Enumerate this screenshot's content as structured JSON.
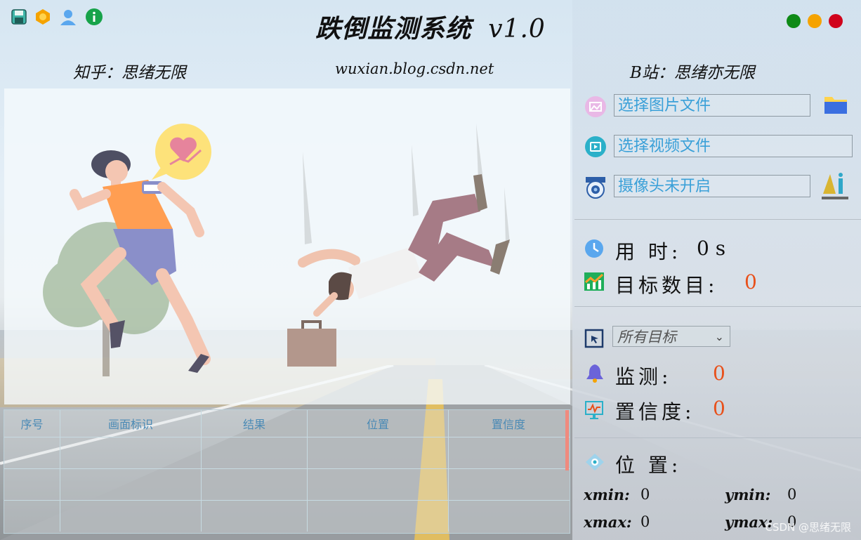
{
  "window": {
    "title": "跌倒监测系统",
    "version": "v1.0",
    "subtitle_left": "知乎：思绪无限",
    "subtitle_center": "wuxian.blog.csdn.net",
    "subtitle_right": "B站：思绪亦无限",
    "watermark": "CSDN @思绪无限"
  },
  "topbar": {
    "icons": [
      "save-icon",
      "hexagon-icon",
      "user-icon",
      "info-icon"
    ],
    "window_controls": [
      {
        "name": "minimize",
        "color": "#0e8a16"
      },
      {
        "name": "maximize",
        "color": "#f5a300"
      },
      {
        "name": "close",
        "color": "#d0021b"
      }
    ]
  },
  "controls": {
    "image_file": "选择图片文件",
    "video_file": "选择视频文件",
    "camera": "摄像头未开启"
  },
  "stats": {
    "time_label": "用 时:",
    "time_value": "0 s",
    "count_label": "目标数目:",
    "count_value": "0"
  },
  "filter": {
    "selected": "所有目标"
  },
  "detection": {
    "monitor_label": "监测:",
    "monitor_value": "0",
    "confidence_label": "置信度:",
    "confidence_value": "0"
  },
  "position": {
    "label": "位 置:",
    "xmin_label": "xmin:",
    "xmin": "0",
    "ymin_label": "ymin:",
    "ymin": "0",
    "xmax_label": "xmax:",
    "xmax": "0",
    "ymax_label": "ymax:",
    "ymax": "0"
  },
  "table": {
    "columns": [
      "序号",
      "画面标识",
      "结果",
      "位置",
      "置信度"
    ]
  },
  "colors": {
    "accent_text": "#3aa0d8",
    "value_red": "#e8501a",
    "header_text": "#4a8ab5"
  }
}
